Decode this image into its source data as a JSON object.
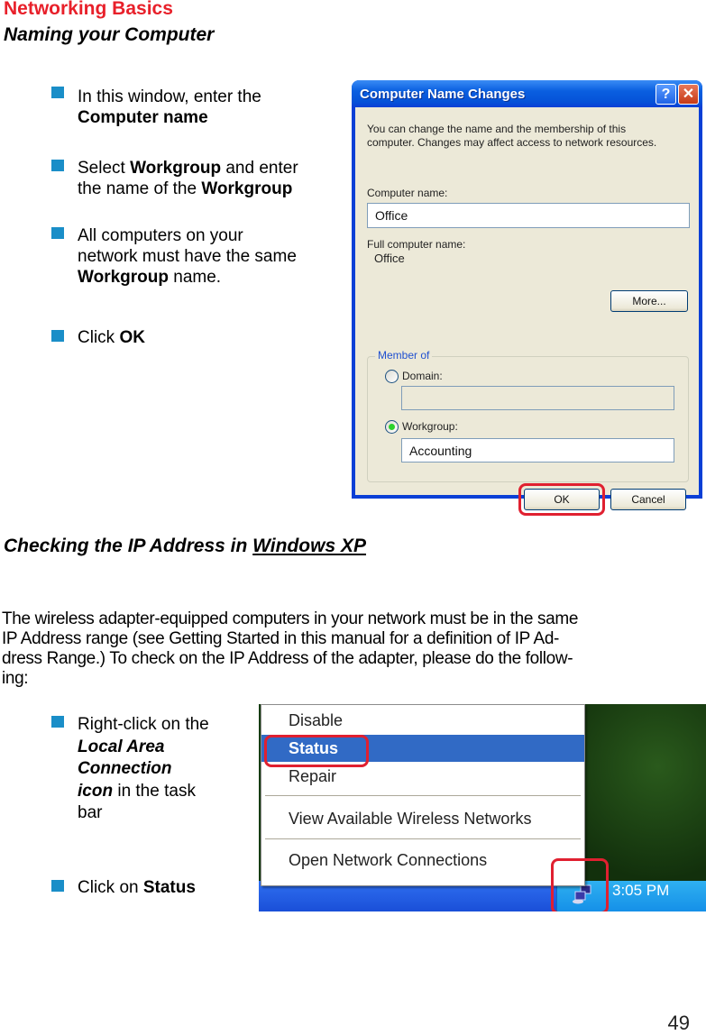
{
  "header": {
    "section": "Networking Basics",
    "subtitle": "Naming your Computer"
  },
  "naming_steps": [
    {
      "pre": "In this window, enter the",
      "bold": "Computer name"
    },
    {
      "pre": "Select ",
      "bold1": "Workgroup",
      "mid": " and enter",
      "line2_pre": "the name of the ",
      "bold2": "Workgroup"
    },
    {
      "line1": "All computers on your",
      "line2": "network must have the same",
      "bold": "Workgroup",
      "post": " name."
    },
    {
      "pre": "Click ",
      "bold": "OK"
    }
  ],
  "dialog": {
    "title": "Computer Name Changes",
    "help_button": "?",
    "close_button": "✕",
    "description_line1": "You can change the name and the membership of this",
    "description_line2": "computer. Changes may affect access to network resources.",
    "computer_name_label": "Computer name:",
    "computer_name_value": "Office",
    "full_name_label": "Full computer name:",
    "full_name_value": "Office",
    "more_button": "More...",
    "member_of_label": "Member of",
    "domain_label": "Domain:",
    "domain_value": "",
    "domain_selected": false,
    "workgroup_label": "Workgroup:",
    "workgroup_value": "Accounting",
    "workgroup_selected": true,
    "ok_button": "OK",
    "cancel_button": "Cancel",
    "highlight_color": "#e02030"
  },
  "ip_section": {
    "heading_pre": "Checking the IP Address in ",
    "heading_link": "Windows XP",
    "paragraph_lines": [
      "The wireless adapter-equipped computers in your network must be in the same",
      "IP Address range (see Getting Started in this manual for a definition of IP Ad-",
      "dress Range.)  To check on the IP Address of the adapter, please do the follow-",
      "ing:"
    ]
  },
  "ip_steps": [
    {
      "pre": "Right-click on the",
      "bi1": "Local Area",
      "bi2": "Connection",
      "bi3": "icon",
      "post": " in the task",
      "post2": "bar"
    },
    {
      "pre": "Click on ",
      "bold": "Status"
    }
  ],
  "context_menu": {
    "items": [
      "Disable",
      "Status",
      "Repair",
      "View Available Wireless Networks",
      "Open Network Connections"
    ],
    "selected": "Status"
  },
  "taskbar": {
    "clock": "3:05 PM",
    "tray_icon": "local-area-connection-icon"
  },
  "page_number": "49",
  "colors": {
    "heading_red": "#e8202a",
    "bullet_blue": "#1a8ec8",
    "xp_title_blue": "#0552d8",
    "menu_highlight": "#316ac5"
  }
}
